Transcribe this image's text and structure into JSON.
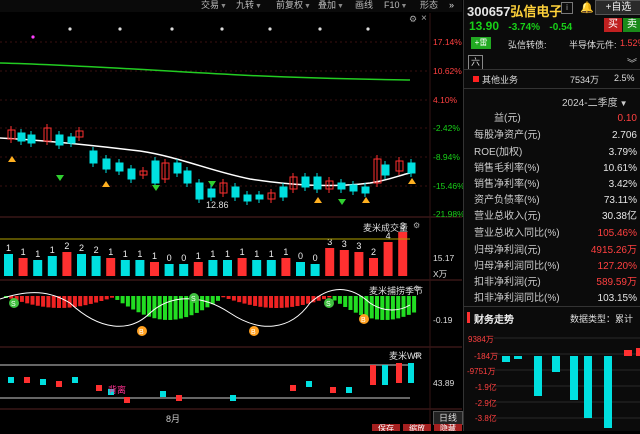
{
  "toolbar": {
    "items": [
      {
        "label": "交易",
        "dropdown": true
      },
      {
        "label": "九转",
        "dropdown": true
      },
      {
        "label": "前复权",
        "dropdown": true
      },
      {
        "label": "叠加",
        "dropdown": true
      },
      {
        "label": "画线",
        "dropdown": false
      },
      {
        "label": "F10",
        "dropdown": true
      },
      {
        "label": "形态",
        "dropdown": false
      }
    ]
  },
  "main_pane": {
    "price_labels": [
      "17.14%",
      "10.62%",
      "4.10%",
      "-2.42%",
      "-8.94%",
      "-15.46%",
      "-21.98%"
    ],
    "low_label": "12.86"
  },
  "volume_pane": {
    "title": "麦米成交量",
    "value": "15.17",
    "unit": "X万",
    "counters": [
      "1",
      "1",
      "1",
      "1",
      "2",
      "2",
      "2",
      "1",
      "1",
      "1",
      "1",
      "0",
      "0",
      "1",
      "1",
      "1",
      "1",
      "1",
      "1",
      "1",
      "0",
      "0",
      "3",
      "3",
      "3",
      "2",
      "4",
      "3"
    ],
    "badge": "涨"
  },
  "season_pane": {
    "title": "麦米捕捞季节",
    "value": "-0.19",
    "markers": [
      "S",
      "B",
      "S",
      "B",
      "S",
      "B"
    ]
  },
  "wr_pane": {
    "title": "麦米WR",
    "value": "43.89",
    "annotation": "背离"
  },
  "x_axis": {
    "month_label": "8月"
  },
  "bottom": {
    "period_button": "日线",
    "save_button": "保存",
    "zoom_button": "缩放",
    "hide_button": "隐藏"
  },
  "stock": {
    "code": "300657",
    "name": "弘信电子",
    "price": "13.90",
    "change_pct": "-3.74%",
    "change": "-0.54",
    "buy_label": "买",
    "sell_label": "卖",
    "add_watch_label": "自选",
    "tag": "雷",
    "bond_label": "弘信转债:",
    "sector_label": "半导体元件:",
    "sector_change": "1.52%",
    "tab_label": "六"
  },
  "business": {
    "name": "其他业务",
    "amount": "7534万",
    "pct": "2.5%"
  },
  "period_select": "2024-二季度",
  "financials": [
    {
      "k": "益(元)",
      "v": "0.10",
      "color": "red"
    },
    {
      "k": "每股净资产(元)",
      "v": "2.706",
      "color": "white"
    },
    {
      "k": "ROE(加权)",
      "v": "3.79%",
      "color": "white"
    },
    {
      "k": "销售毛利率(%)",
      "v": "10.61%",
      "color": "white"
    },
    {
      "k": "销售净利率(%)",
      "v": "3.42%",
      "color": "white"
    },
    {
      "k": "资产负债率(%)",
      "v": "73.11%",
      "color": "white"
    },
    {
      "k": "营业总收入(元)",
      "v": "30.38亿",
      "color": "white"
    },
    {
      "k": "营业总收入同比(%)",
      "v": "105.46%",
      "color": "red"
    },
    {
      "k": "归母净利润(元)",
      "v": "4915.26万",
      "color": "red"
    },
    {
      "k": "归母净利润同比(%)",
      "v": "127.20%",
      "color": "red"
    },
    {
      "k": "扣非净利润(元)",
      "v": "589.59万",
      "color": "red"
    },
    {
      "k": "扣非净利润同比(%)",
      "v": "103.15%",
      "color": "white"
    }
  ],
  "finance_chart": {
    "title": "财务走势",
    "type_label": "数据类型：",
    "type_value": "累计",
    "y_labels": [
      "9384万",
      "-184万",
      "-9751万",
      "-1.9亿",
      "-2.9亿",
      "-3.8亿",
      "-4.8亿"
    ]
  },
  "colors": {
    "up": "#ff3030",
    "down": "#00e0e0",
    "green_bar": "#22dd22",
    "ma": "#ffffff",
    "ma_green": "#22cc22"
  }
}
